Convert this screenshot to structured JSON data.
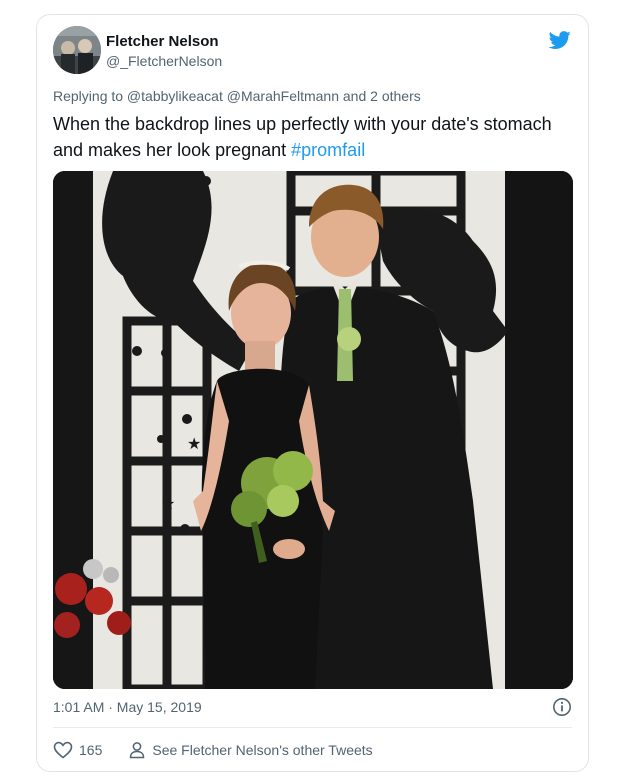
{
  "tweet": {
    "author": {
      "name": "Fletcher Nelson",
      "handle": "@_FletcherNelson",
      "avatar_icon": "profile-photo"
    },
    "brand_icon": "twitter-bird-icon",
    "brand_color": "#1d9bf0",
    "replying_to": "Replying to @tabbylikeacat @MarahFeltmann and 2 others",
    "text": "When the backdrop lines up perfectly with your date's stomach and makes her look pregnant ",
    "hashtag": "#promfail",
    "timestamp": "1:01 AM · May 15, 2019",
    "info_icon": "info-icon",
    "likes": {
      "icon": "heart-icon",
      "count": "165"
    },
    "other_tweets": {
      "icon": "person-icon",
      "label": "See Fletcher Nelson's other Tweets"
    }
  },
  "colors": {
    "text_primary": "#0f1419",
    "text_secondary": "#536471",
    "link": "#1d9bf0",
    "border": "#dfe4e8"
  }
}
